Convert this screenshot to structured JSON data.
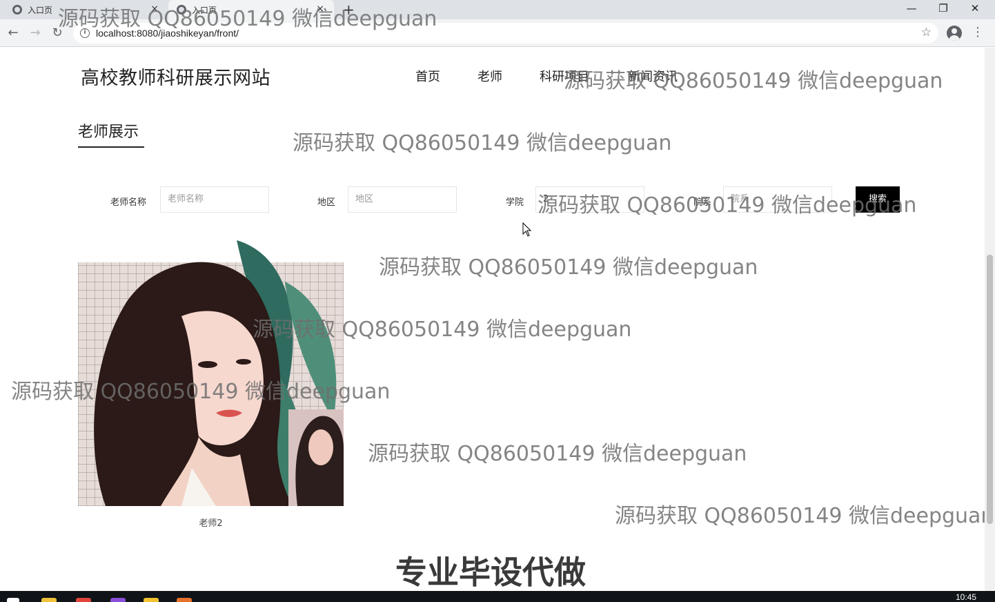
{
  "browser": {
    "tabs": [
      {
        "label": "入口页",
        "close": "×"
      },
      {
        "label": "入口页",
        "close": "×"
      }
    ],
    "new_tab": "+",
    "window_controls": {
      "minimize": "—",
      "maximize": "❐",
      "close": "✕"
    },
    "nav": {
      "back": "←",
      "forward": "→",
      "reload": "↻"
    },
    "url": "localhost:8080/jiaoshikeyan/front/",
    "info_glyph": "i",
    "star": "☆",
    "menu": "⋮"
  },
  "site": {
    "title": "高校教师科研展示网站",
    "nav": [
      "首页",
      "老师",
      "科研项目",
      "新闻资讯"
    ]
  },
  "section": {
    "title": "老师展示"
  },
  "filters": {
    "teacher_name": {
      "label": "老师名称",
      "placeholder": "老师名称",
      "value": ""
    },
    "region": {
      "label": "地区",
      "placeholder": "地区",
      "value": ""
    },
    "college": {
      "label": "学院",
      "placeholder": "学院",
      "value": "2"
    },
    "department": {
      "label": "院系",
      "placeholder": "院系",
      "value": ""
    },
    "search_label": "搜索"
  },
  "teachers": [
    {
      "name": "老师2"
    }
  ],
  "watermark": "源码获取 QQ86050149 微信deepguan",
  "banner": "专业毕设代做",
  "taskbar": {
    "clock": "10:45"
  }
}
